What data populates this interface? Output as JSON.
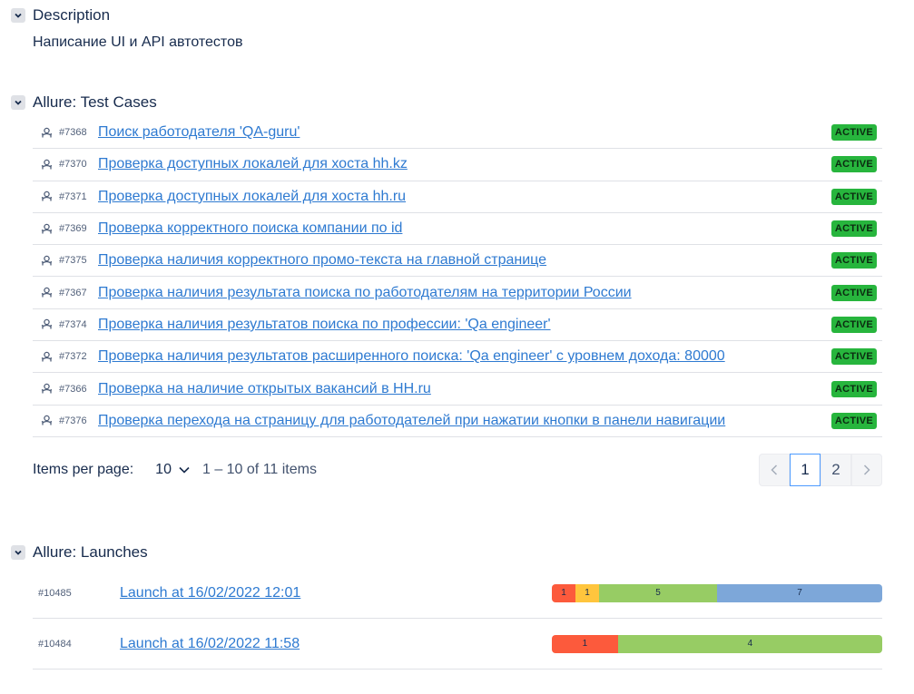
{
  "description": {
    "title": "Description",
    "text": "Написание UI и API автотестов"
  },
  "test_cases": {
    "title": "Allure: Test Cases",
    "items": [
      {
        "id": "#7368",
        "name": "Поиск работодателя 'QA-guru'",
        "status": "ACTIVE"
      },
      {
        "id": "#7370",
        "name": "Проверка доступных локалей для хоста hh.kz",
        "status": "ACTIVE"
      },
      {
        "id": "#7371",
        "name": "Проверка доступных локалей для хоста hh.ru",
        "status": "ACTIVE"
      },
      {
        "id": "#7369",
        "name": "Проверка корректного поиска компании по id",
        "status": "ACTIVE"
      },
      {
        "id": "#7375",
        "name": "Проверка наличия корректного промо-текста на главной странице",
        "status": "ACTIVE"
      },
      {
        "id": "#7367",
        "name": "Проверка наличия результата поиска по работодателям на территории России",
        "status": "ACTIVE"
      },
      {
        "id": "#7374",
        "name": "Проверка наличия результатов поиска по профессии: 'Qa engineer'",
        "status": "ACTIVE"
      },
      {
        "id": "#7372",
        "name": "Проверка наличия результатов расширенного поиска: 'Qa engineer' с уровнем дохода: 80000",
        "status": "ACTIVE"
      },
      {
        "id": "#7366",
        "name": "Проверка на наличие открытых вакансий в HH.ru",
        "status": "ACTIVE"
      },
      {
        "id": "#7376",
        "name": "Проверка перехода на страницу для работодателей при нажатии кнопки в панели навигации",
        "status": "ACTIVE"
      }
    ],
    "pagination": {
      "items_per_page_label": "Items per page:",
      "items_per_page_value": "10",
      "range_text": "1 – 10 of 11 items",
      "pages": [
        "1",
        "2"
      ],
      "current_page": "1"
    }
  },
  "launches": {
    "title": "Allure: Launches",
    "items": [
      {
        "id": "#10485",
        "name": "Launch at 16/02/2022 12:01",
        "stats": [
          {
            "label": "1",
            "value": 1,
            "color": "#fc5a3c"
          },
          {
            "label": "1",
            "value": 1,
            "color": "#ffc53d"
          },
          {
            "label": "5",
            "value": 5,
            "color": "#97cc64"
          },
          {
            "label": "7",
            "value": 7,
            "color": "#7da7d9"
          }
        ]
      },
      {
        "id": "#10484",
        "name": "Launch at 16/02/2022 11:58",
        "stats": [
          {
            "label": "1",
            "value": 1,
            "color": "#fc5a3c"
          },
          {
            "label": "4",
            "value": 4,
            "color": "#97cc64"
          }
        ]
      }
    ]
  },
  "colors": {
    "link": "#2e7ad1",
    "active_badge": "#27b53d"
  }
}
